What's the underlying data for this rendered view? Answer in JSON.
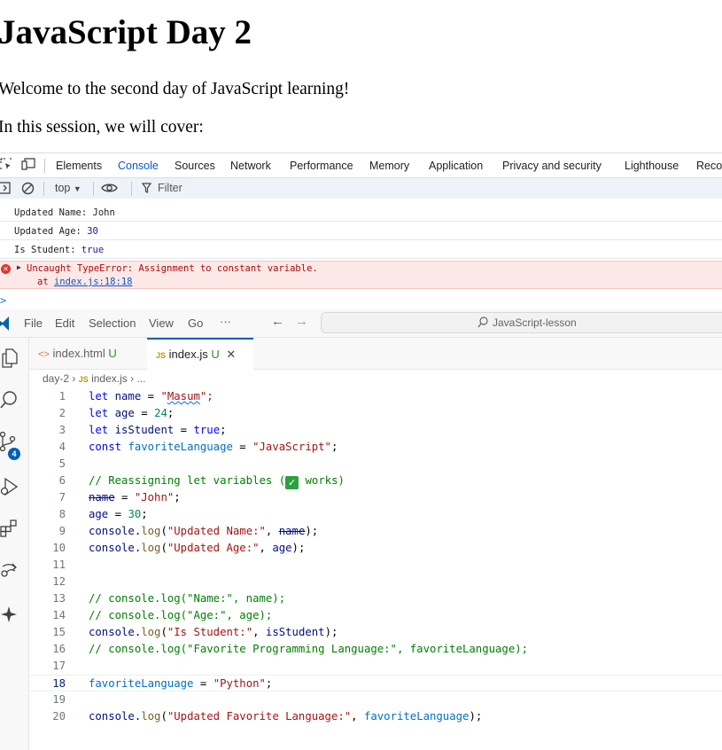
{
  "page": {
    "heading": "JavaScript Day 2",
    "paragraph1": "Welcome to the second day of JavaScript learning!",
    "paragraph2": "In this session, we will cover:"
  },
  "devtools": {
    "tabs": [
      "Elements",
      "Console",
      "Sources",
      "Network",
      "Performance",
      "Memory",
      "Application",
      "Privacy and security",
      "Lighthouse",
      "Recorder"
    ],
    "active_tab": "Console",
    "context": "top",
    "filter_placeholder": "Filter",
    "console": {
      "logs": [
        {
          "label": "Updated Name: ",
          "value": "John",
          "value_type": "string"
        },
        {
          "label": "Updated Age: ",
          "value": "30",
          "value_type": "number"
        },
        {
          "label": "Is Student: ",
          "value": "true",
          "value_type": "boolean"
        }
      ],
      "error": {
        "message": "Uncaught TypeError: Assignment to constant variable.",
        "at_prefix": "at ",
        "location": "index.js:18:18"
      },
      "prompt": ">"
    }
  },
  "vscode": {
    "menu": [
      "File",
      "Edit",
      "Selection",
      "View",
      "Go"
    ],
    "overflow": "···",
    "search_text": "JavaScript-lesson",
    "scm_badge": "4",
    "tabs": [
      {
        "icon": "<>",
        "name": "index.html",
        "status": "U",
        "active": false
      },
      {
        "icon": "JS",
        "name": "index.js",
        "status": "U",
        "active": true
      }
    ],
    "breadcrumb": {
      "folder": "day-2",
      "file_icon": "JS",
      "file": "index.js",
      "more": "..."
    },
    "current_line": 18,
    "code_lines": [
      [
        {
          "t": "let",
          "c": "t-kw"
        },
        {
          "t": " "
        },
        {
          "t": "name",
          "c": "t-var"
        },
        {
          "t": " = "
        },
        {
          "t": "\"",
          "c": "t-str"
        },
        {
          "t": "Masum",
          "c": "t-str squiggle"
        },
        {
          "t": "\";",
          "c": "t-str"
        }
      ],
      [
        {
          "t": "let",
          "c": "t-kw"
        },
        {
          "t": " "
        },
        {
          "t": "age",
          "c": "t-var"
        },
        {
          "t": " = "
        },
        {
          "t": "24",
          "c": "t-num"
        },
        {
          "t": ";"
        }
      ],
      [
        {
          "t": "let",
          "c": "t-kw"
        },
        {
          "t": " "
        },
        {
          "t": "isStudent",
          "c": "t-var"
        },
        {
          "t": " = "
        },
        {
          "t": "true",
          "c": "t-kw"
        },
        {
          "t": ";"
        }
      ],
      [
        {
          "t": "const",
          "c": "t-kw"
        },
        {
          "t": " "
        },
        {
          "t": "favoriteLanguage",
          "c": "t-const"
        },
        {
          "t": " = "
        },
        {
          "t": "\"JavaScript\"",
          "c": "t-str"
        },
        {
          "t": ";"
        }
      ],
      [],
      [
        {
          "t": "// Reassigning let variables (",
          "c": "t-com"
        },
        {
          "t": "✓",
          "c": "check"
        },
        {
          "t": " works)",
          "c": "t-com"
        }
      ],
      [
        {
          "t": "name",
          "c": "t-var t-strike"
        },
        {
          "t": " = "
        },
        {
          "t": "\"John\"",
          "c": "t-str"
        },
        {
          "t": ";"
        }
      ],
      [
        {
          "t": "age",
          "c": "t-var"
        },
        {
          "t": " = "
        },
        {
          "t": "30",
          "c": "t-num"
        },
        {
          "t": ";"
        }
      ],
      [
        {
          "t": "console",
          "c": "t-var"
        },
        {
          "t": "."
        },
        {
          "t": "log",
          "c": "t-fn"
        },
        {
          "t": "("
        },
        {
          "t": "\"Updated Name:\"",
          "c": "t-str"
        },
        {
          "t": ", "
        },
        {
          "t": "name",
          "c": "t-var t-strike"
        },
        {
          "t": ");"
        }
      ],
      [
        {
          "t": "console",
          "c": "t-var"
        },
        {
          "t": "."
        },
        {
          "t": "log",
          "c": "t-fn"
        },
        {
          "t": "("
        },
        {
          "t": "\"Updated Age:\"",
          "c": "t-str"
        },
        {
          "t": ", "
        },
        {
          "t": "age",
          "c": "t-var"
        },
        {
          "t": ");"
        }
      ],
      [],
      [],
      [
        {
          "t": "// console.log(\"Name:\", name);",
          "c": "t-com"
        }
      ],
      [
        {
          "t": "// console.log(\"Age:\", age);",
          "c": "t-com"
        }
      ],
      [
        {
          "t": "console",
          "c": "t-var"
        },
        {
          "t": "."
        },
        {
          "t": "log",
          "c": "t-fn"
        },
        {
          "t": "("
        },
        {
          "t": "\"Is Student:\"",
          "c": "t-str"
        },
        {
          "t": ", "
        },
        {
          "t": "isStudent",
          "c": "t-var"
        },
        {
          "t": ");"
        }
      ],
      [
        {
          "t": "// console.log(\"Favorite Programming Language:\", favoriteLanguage);",
          "c": "t-com"
        }
      ],
      [],
      [
        {
          "t": "favoriteLanguage",
          "c": "t-const"
        },
        {
          "t": " = "
        },
        {
          "t": "\"Python\"",
          "c": "t-str"
        },
        {
          "t": ";"
        }
      ],
      [],
      [
        {
          "t": "console",
          "c": "t-var"
        },
        {
          "t": "."
        },
        {
          "t": "log",
          "c": "t-fn"
        },
        {
          "t": "("
        },
        {
          "t": "\"Updated Favorite Language:\"",
          "c": "t-str"
        },
        {
          "t": ", "
        },
        {
          "t": "favoriteLanguage",
          "c": "t-const"
        },
        {
          "t": ");"
        }
      ]
    ]
  }
}
